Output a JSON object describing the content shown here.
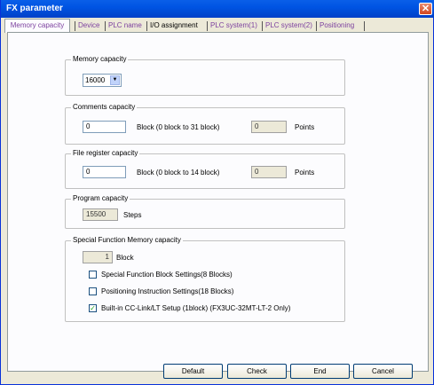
{
  "window": {
    "title": "FX parameter"
  },
  "tabs": [
    "Memory capacity",
    "Device",
    "PLC name",
    "I/O assignment",
    "PLC system(1)",
    "PLC system(2)",
    "Positioning"
  ],
  "memory_capacity": {
    "legend": "Memory capacity",
    "value": "16000"
  },
  "comments_capacity": {
    "legend": "Comments capacity",
    "value": "0",
    "range_label": "Block (0 block to 31 block)",
    "points_value": "0",
    "points_label": "Points"
  },
  "file_register": {
    "legend": "File register capacity",
    "value": "0",
    "range_label": "Block (0 block to 14 block)",
    "points_value": "0",
    "points_label": "Points"
  },
  "program_capacity": {
    "legend": "Program capacity",
    "value": "15500",
    "unit": "Steps"
  },
  "special_function": {
    "legend": "Special Function Memory capacity",
    "block_value": "1",
    "block_label": "Block",
    "options": [
      {
        "label": "Special Function Block Settings(8 Blocks)",
        "checked": false
      },
      {
        "label": "Positioning Instruction Settings(18 Blocks)",
        "checked": false
      },
      {
        "label": "Built-in CC-Link/LT Setup (1block)  (FX3UC-32MT-LT-2 Only)",
        "checked": true
      }
    ]
  },
  "buttons": {
    "default": "Default",
    "check": "Check",
    "end": "End",
    "cancel": "Cancel"
  }
}
